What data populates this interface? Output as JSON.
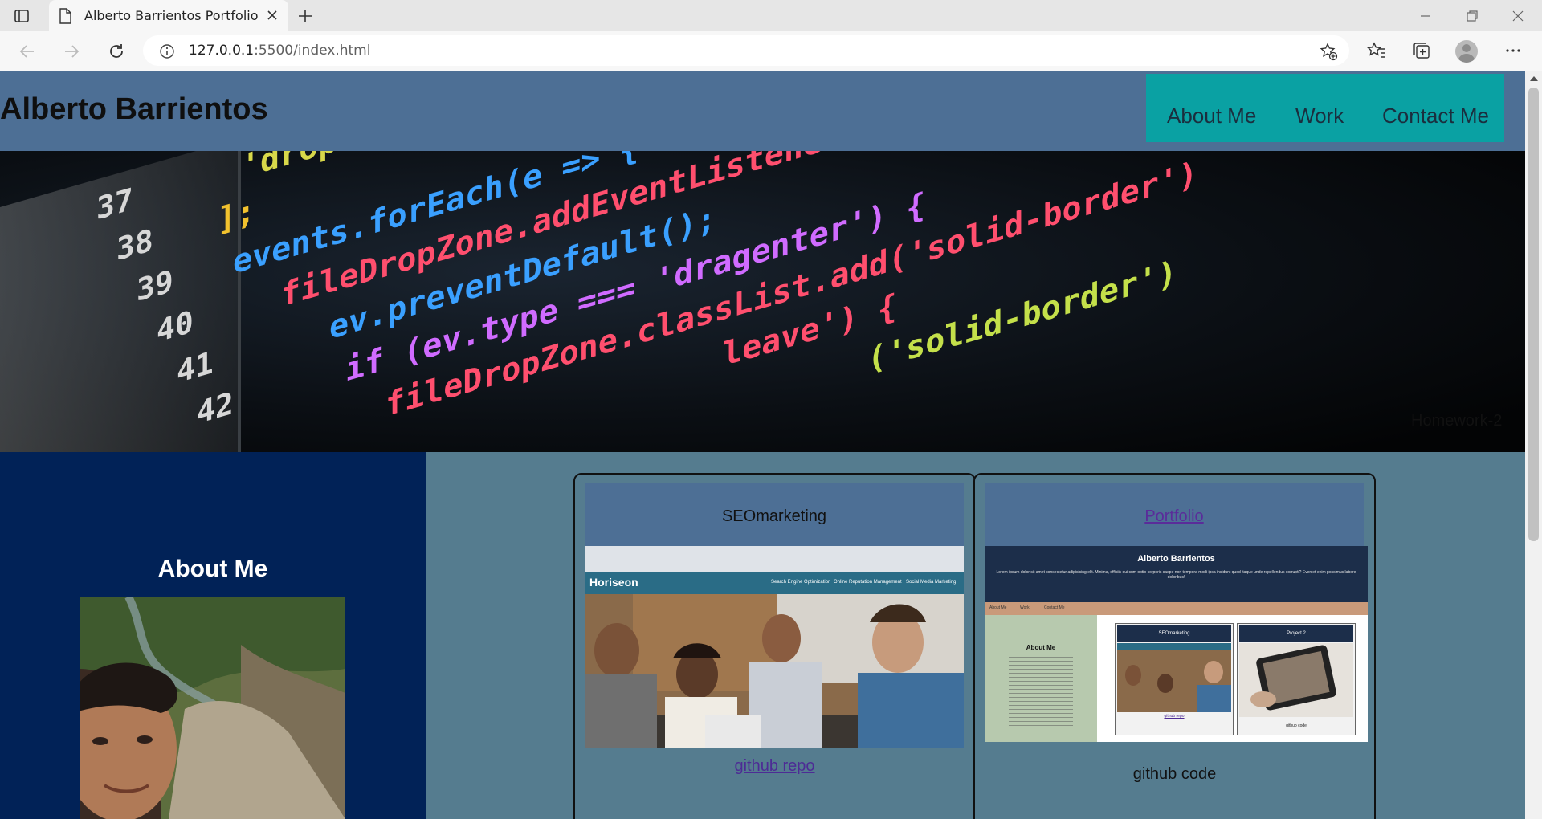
{
  "browser": {
    "tab_title": "Alberto Barrientos Portfolio",
    "url_host": "127.0.0.1",
    "url_path": ":5500/index.html"
  },
  "site": {
    "name": "Alberto Barrientos",
    "nav": [
      "About Me",
      "Work",
      "Contact Me"
    ],
    "hero_caption": "Homework-2"
  },
  "hero_code": {
    "line_numbers": [
      "37",
      "38",
      "39",
      "40",
      "41",
      "42"
    ],
    "lines": [
      "'drop'",
      "];",
      "events.forEach(e => {",
      "fileDropZone.addEventListener(e, (ev) => {",
      "ev.preventDefault();",
      "if (ev.type === 'dragenter') {",
      "fileDropZone.classList.add('solid-border')",
      "leave') {",
      "('solid-border')"
    ]
  },
  "about": {
    "heading": "About Me"
  },
  "work": [
    {
      "title": "SEOmarketing",
      "link": "github repo",
      "shot": {
        "brand": "Horiseon",
        "nav": [
          "Search Engine Optimization",
          "Online Reputation Management",
          "Social Media Marketing"
        ]
      }
    },
    {
      "title": "Portfolio",
      "link": "github code",
      "shot": {
        "name": "Alberto Barrientos",
        "blurb": "Lorem ipsum dolor sit amet consectetur adipisicing elit. Minima, officiis qui cum optio corporis saepe non tempora modi ipsa incidunt quod itaque unde repellendus corrupti? Eveniet enim possimus labore doloribus!",
        "nav": [
          "About Me",
          "Work",
          "Contact Me"
        ],
        "about_heading": "About Me",
        "card1": "SEOmarketing",
        "card2": "Project 2",
        "card1_link": "github repo",
        "card2_link": "github code"
      }
    }
  ],
  "colors": {
    "header": "#4d6f95",
    "nav": "#0aa1a3",
    "about_bg": "#012257",
    "work_bg": "#557c8f"
  }
}
